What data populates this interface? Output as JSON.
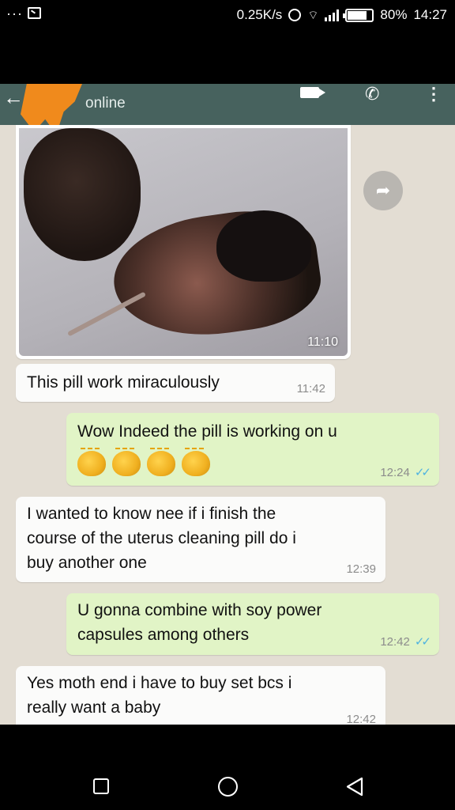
{
  "status_bar": {
    "dots": "···",
    "speed": "0.25K/s",
    "battery_percent": "80%",
    "battery_level": 0.8,
    "time": "14:27",
    "icons": [
      "screenshot-icon",
      "alarm-icon",
      "wifi-icon",
      "signal-icon",
      "battery-icon"
    ]
  },
  "app_bar": {
    "status": "online",
    "icons": [
      "back-arrow-icon",
      "video-call-icon",
      "phone-icon",
      "more-menu-icon"
    ]
  },
  "messages": [
    {
      "type": "image",
      "direction": "incoming",
      "time": "11:10"
    },
    {
      "type": "text",
      "direction": "incoming",
      "text": "This pill work miraculously",
      "time": "11:42"
    },
    {
      "type": "text",
      "direction": "outgoing",
      "text": "Wow Indeed the pill is working on u",
      "emoji": "clapping-hands x4",
      "time": "12:24",
      "read": true
    },
    {
      "type": "text",
      "direction": "incoming",
      "text": "I wanted to know nee if i finish the\ncourse of the uterus cleaning pill do i\nbuy another one",
      "time": "12:39"
    },
    {
      "type": "text",
      "direction": "outgoing",
      "text": "U gonna combine with soy power\ncapsules among others",
      "time": "12:42",
      "read": true
    },
    {
      "type": "text",
      "direction": "incoming",
      "text": "Yes moth end i have to buy set bcs i\nreally  want a baby",
      "time": "12:42"
    }
  ],
  "ticks": "✓✓",
  "nav_bar": {
    "icons": [
      "recent-apps-icon",
      "home-icon",
      "back-icon"
    ]
  },
  "colors": {
    "app_bar": "#47625e",
    "outgoing_bubble": "#e1f4c6",
    "incoming_bubble": "#fbfbfa",
    "chat_bg": "#e3ddd3",
    "read_ticks": "#4fb3e0"
  }
}
